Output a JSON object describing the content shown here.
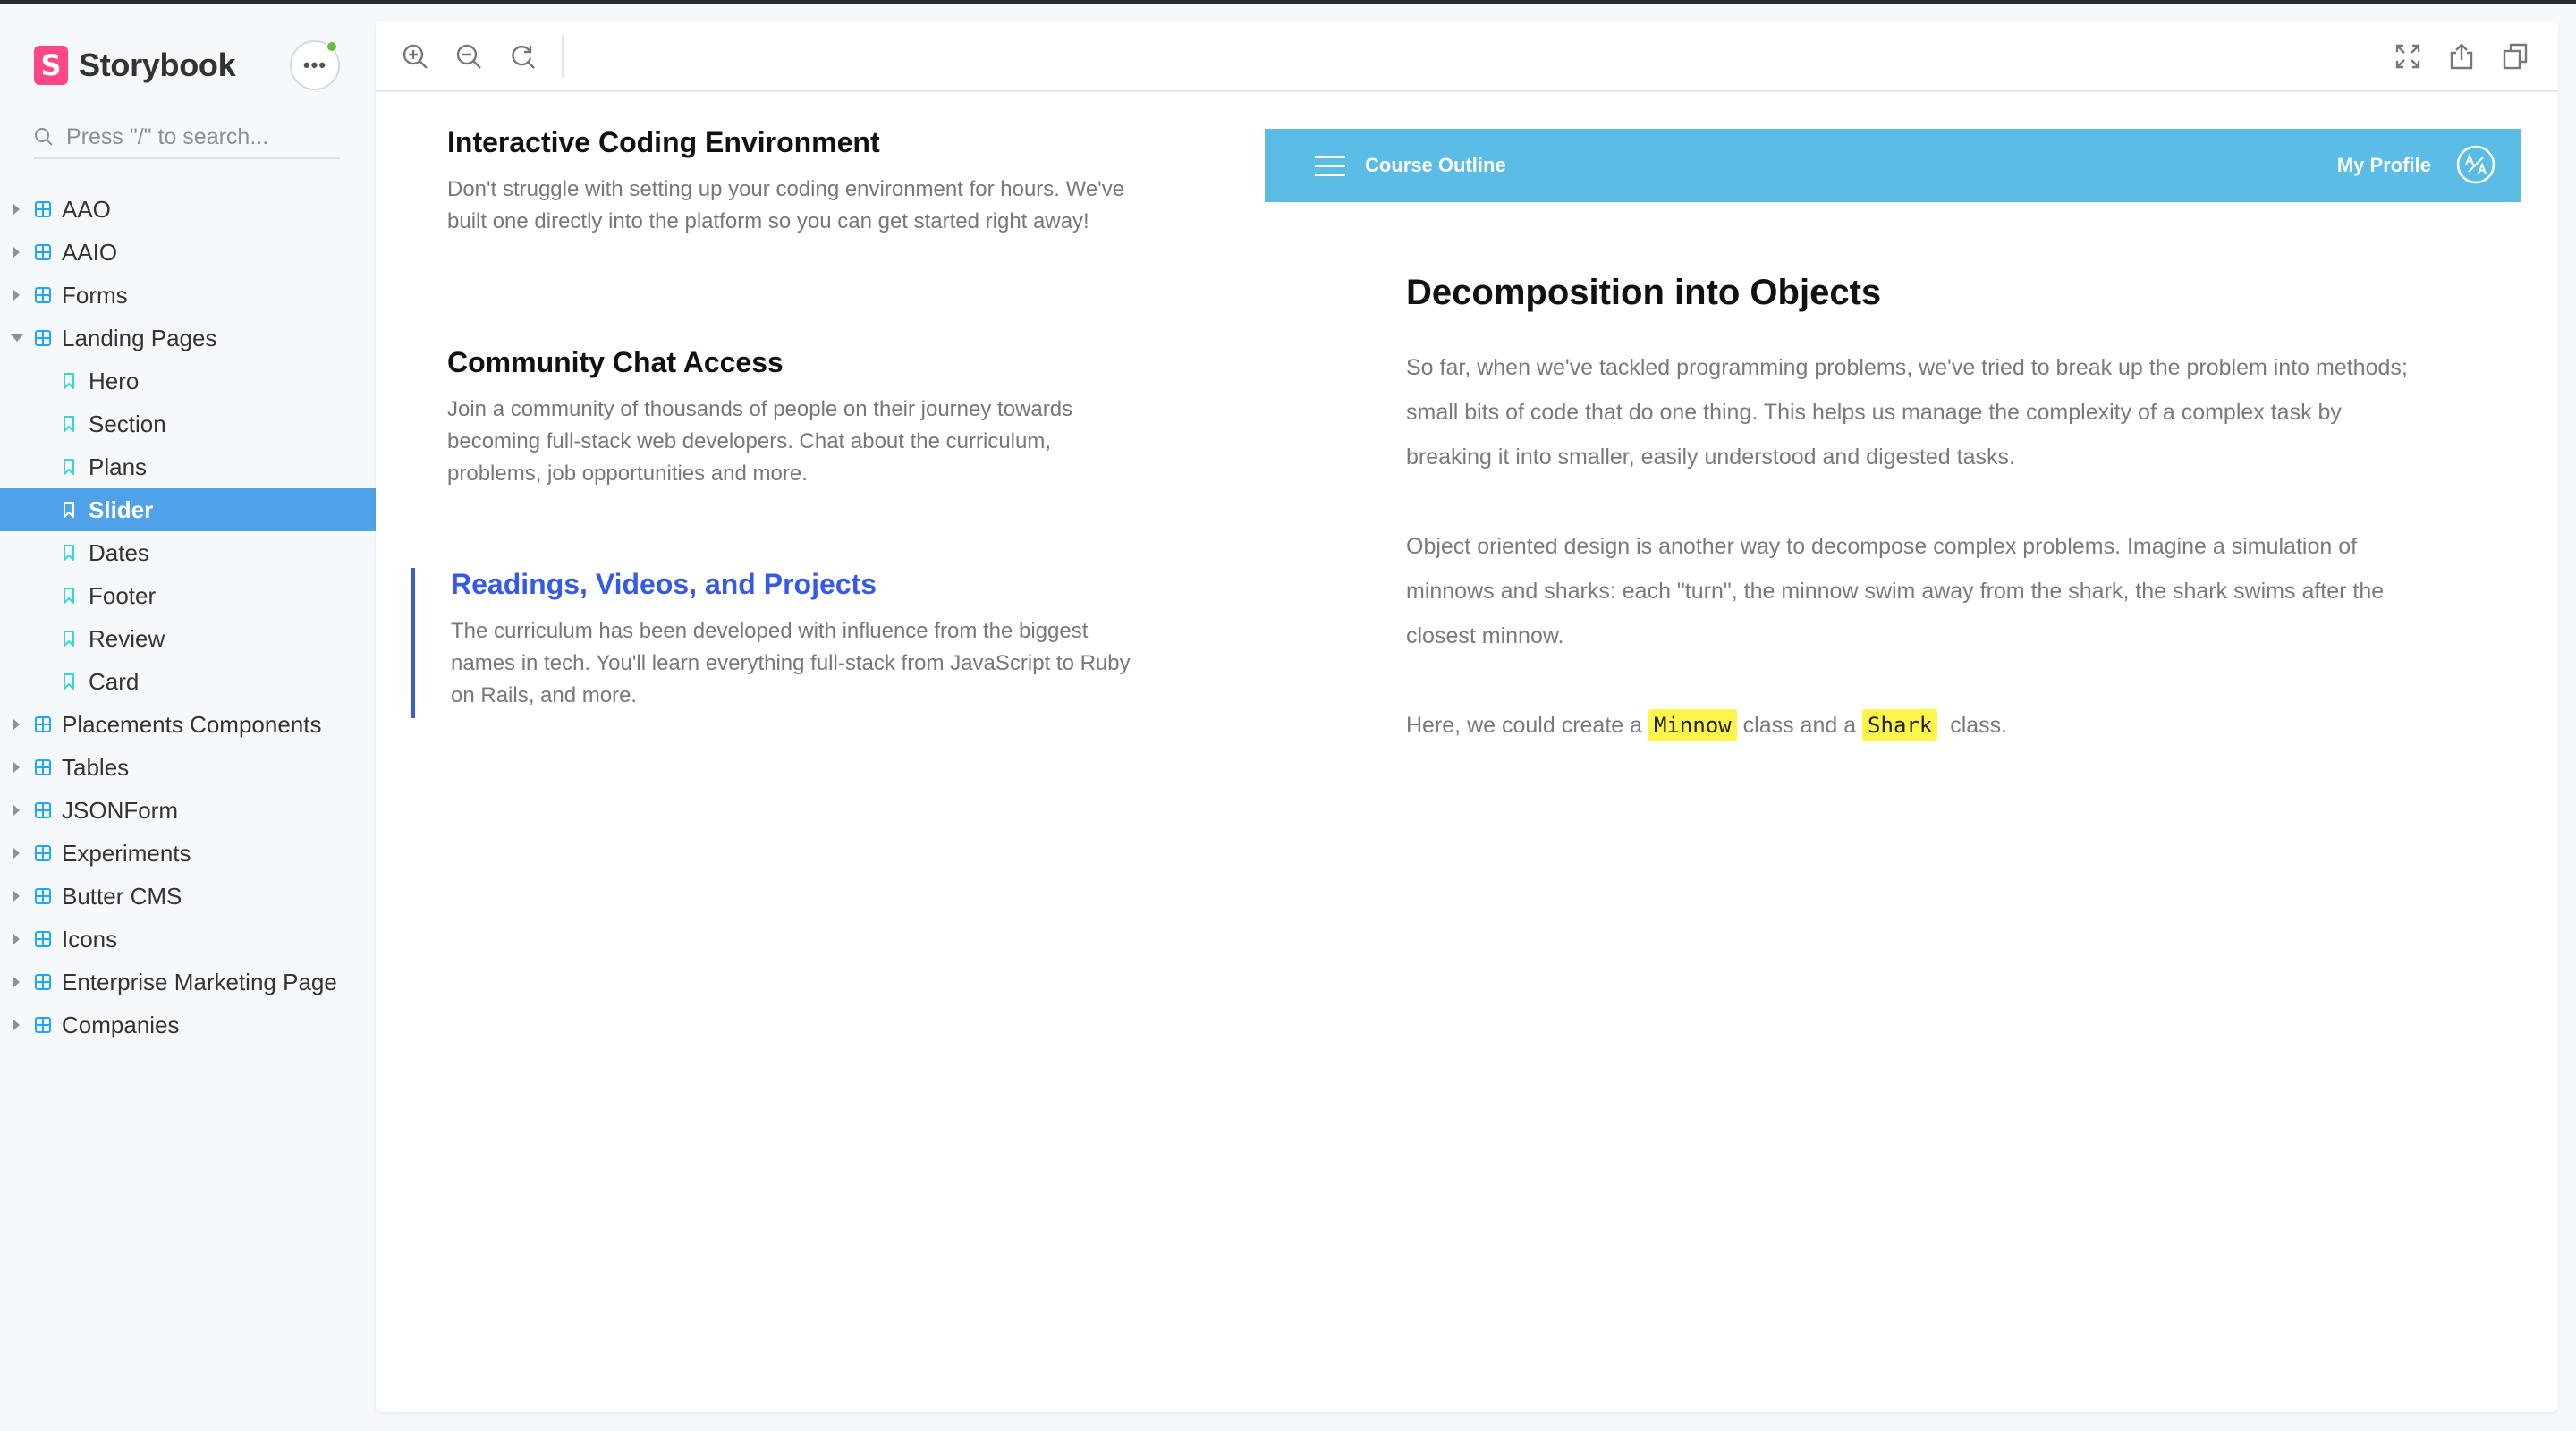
{
  "sidebar": {
    "brand": {
      "logo_letter": "S",
      "name": "Storybook"
    },
    "menu_label": "•••",
    "search": {
      "placeholder": "Press \"/\" to search..."
    },
    "items": [
      {
        "label": "AAO",
        "kind": "component"
      },
      {
        "label": "AAIO",
        "kind": "component"
      },
      {
        "label": "Forms",
        "kind": "component"
      },
      {
        "label": "Landing Pages",
        "kind": "component",
        "expanded": true
      },
      {
        "label": "Hero",
        "kind": "story"
      },
      {
        "label": "Section",
        "kind": "story"
      },
      {
        "label": "Plans",
        "kind": "story"
      },
      {
        "label": "Slider",
        "kind": "story",
        "active": true
      },
      {
        "label": "Dates",
        "kind": "story"
      },
      {
        "label": "Footer",
        "kind": "story"
      },
      {
        "label": "Review",
        "kind": "story"
      },
      {
        "label": "Card",
        "kind": "story"
      },
      {
        "label": "Placements Components",
        "kind": "component"
      },
      {
        "label": "Tables",
        "kind": "component"
      },
      {
        "label": "JSONForm",
        "kind": "component"
      },
      {
        "label": "Experiments",
        "kind": "component"
      },
      {
        "label": "Butter CMS",
        "kind": "component"
      },
      {
        "label": "Icons",
        "kind": "component"
      },
      {
        "label": "Enterprise Marketing Page",
        "kind": "component"
      },
      {
        "label": "Companies",
        "kind": "component"
      }
    ]
  },
  "toolbar": {
    "left_icons": [
      "zoom-in-icon",
      "zoom-out-icon",
      "reset-zoom-icon"
    ],
    "right_icons": [
      "fullscreen-icon",
      "share-icon",
      "copy-icon"
    ]
  },
  "features": [
    {
      "title": "Interactive Coding Environment",
      "text": "Don't struggle with setting up your coding environment for hours. We've built one directly into the platform so you can get started right away!"
    },
    {
      "title": "Community Chat Access",
      "text": "Join a community of thousands of people on their journey towards becoming full-stack web developers. Chat about the curriculum, problems, job opportunities and more."
    },
    {
      "title": "Readings, Videos, and Projects",
      "text": "The curriculum has been developed with influence from the biggest names in tech. You'll learn everything full-stack from JavaScript to Ruby on Rails, and more.",
      "active": true
    }
  ],
  "course_bar": {
    "title": "Course Outline",
    "profile": "My Profile",
    "avatar_icon": "avatar-icon"
  },
  "article": {
    "heading": "Decomposition into Objects",
    "p1": "So far, when we've tackled programming problems, we've tried to break up the problem into methods; small bits of code that do one thing. This helps us manage the complexity of a complex task by breaking it into smaller, easily understood and digested tasks.",
    "p2": "Object oriented design is another way to decompose complex problems. Imagine a simulation of minnows and sharks: each \"turn\", the minnow swim away from the shark, the shark swims after the closest minnow.",
    "p3_before": "Here, we could create a ",
    "p3_code1": "Minnow",
    "p3_mid": " class and a ",
    "p3_code2": "Shark",
    "p3_after": "  class."
  },
  "colors": {
    "accent_active": "#4fa2e8",
    "storybook_pink": "#ff4785",
    "course_bar": "#5bbde6",
    "feature_active": "#3759e8",
    "code_highlight": "#fdf54a"
  }
}
